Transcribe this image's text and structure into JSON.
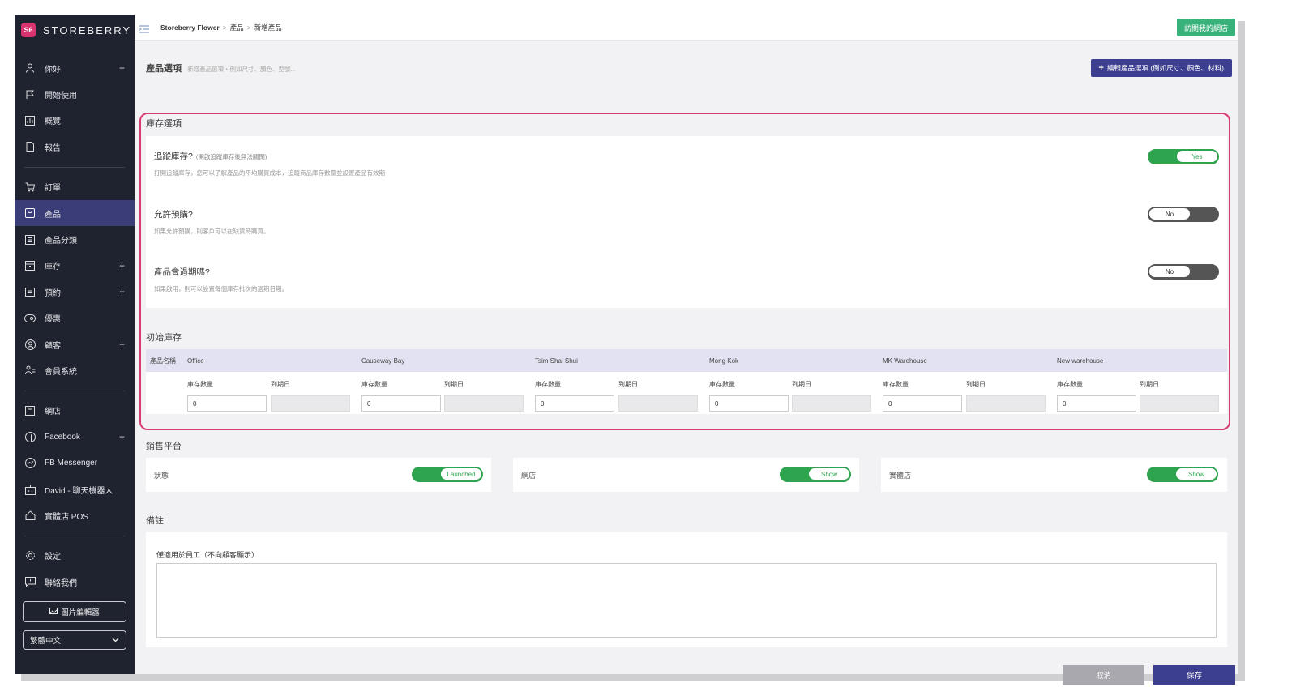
{
  "brand": {
    "logo_text": "S6",
    "name": "STOREBERRY"
  },
  "sidebar": {
    "items": [
      {
        "label": "你好,",
        "icon": "user-icon",
        "plus": "+"
      },
      {
        "label": "開始使用",
        "icon": "flag-icon",
        "plus": ""
      },
      {
        "label": "概覽",
        "icon": "chart-icon",
        "plus": ""
      },
      {
        "label": "報告",
        "icon": "file-icon",
        "plus": ""
      },
      {
        "label": "訂單",
        "icon": "cart-icon",
        "plus": ""
      },
      {
        "label": "產品",
        "icon": "bag-icon",
        "plus": ""
      },
      {
        "label": "產品分類",
        "icon": "list-icon",
        "plus": ""
      },
      {
        "label": "庫存",
        "icon": "box-icon",
        "plus": "+"
      },
      {
        "label": "預約",
        "icon": "calendar-icon",
        "plus": "+"
      },
      {
        "label": "優惠",
        "icon": "ticket-icon",
        "plus": ""
      },
      {
        "label": "顧客",
        "icon": "person-circle-icon",
        "plus": "+"
      },
      {
        "label": "會員系統",
        "icon": "members-icon",
        "plus": ""
      },
      {
        "label": "網店",
        "icon": "store-icon",
        "plus": ""
      },
      {
        "label": "Facebook",
        "icon": "facebook-icon",
        "plus": "+"
      },
      {
        "label": "FB Messenger",
        "icon": "messenger-icon",
        "plus": ""
      },
      {
        "label": "David - 聊天機器人",
        "icon": "bot-icon",
        "plus": ""
      },
      {
        "label": "實體店 POS",
        "icon": "home-icon",
        "plus": ""
      },
      {
        "label": "設定",
        "icon": "gear-icon",
        "plus": ""
      },
      {
        "label": "聯絡我們",
        "icon": "chat-icon",
        "plus": ""
      }
    ],
    "image_editor": "圖片編輯器",
    "language": "繁體中文"
  },
  "header": {
    "breadcrumb": [
      "Storeberry Flower",
      "產品",
      "新增產品"
    ],
    "breadcrumb_sep": ">",
    "visit_store": "訪問我的網店"
  },
  "product_options": {
    "title": "產品選項",
    "subtitle": "新增產品選項・例如尺寸、顏色、型號...",
    "edit_button": "編輯產品選項 (例如尺寸、顏色、材料)"
  },
  "inventory_options": {
    "title": "庫存選項",
    "track": {
      "title": "追蹤庫存?",
      "hint": "(開啟追蹤庫存後無法關閉)",
      "desc": "打開追蹤庫存，您可以了解產品的平均購買成本，追蹤商品庫存數量並設置產品有效期",
      "toggle": "Yes"
    },
    "preorder": {
      "title": "允許預購?",
      "desc": "如果允許預購，則客戶可以在缺貨時購買。",
      "toggle": "No"
    },
    "expiry": {
      "title": "產品會過期嗎?",
      "desc": "如果啟用，則可以設置每個庫存批次的過期日期。",
      "toggle": "No"
    }
  },
  "initial_stock": {
    "title": "初始庫存",
    "product_name_label": "產品名稱",
    "qty_label": "庫存數量",
    "expiry_label": "到期日",
    "locations": [
      {
        "name": "Office",
        "qty": "0"
      },
      {
        "name": "Causeway Bay",
        "qty": "0"
      },
      {
        "name": "Tsim Shai Shui",
        "qty": "0"
      },
      {
        "name": "Mong Kok",
        "qty": "0"
      },
      {
        "name": "MK Warehouse",
        "qty": "0"
      },
      {
        "name": "New warehouse",
        "qty": "0"
      }
    ]
  },
  "sales_channels": {
    "title": "銷售平台",
    "channels": [
      {
        "label": "狀態",
        "toggle": "Launched"
      },
      {
        "label": "網店",
        "toggle": "Show"
      },
      {
        "label": "實體店",
        "toggle": "Show"
      }
    ]
  },
  "notes": {
    "title": "備註",
    "label": "僅適用於員工（不向顧客顯示）",
    "value": ""
  },
  "footer": {
    "cancel": "取消",
    "save": "保存"
  },
  "colors": {
    "sidebar_bg": "#1f2330",
    "active_nav": "#3a3d78",
    "primary": "#3c3f8f",
    "green": "#2fa44f",
    "highlight": "#d83a72"
  }
}
